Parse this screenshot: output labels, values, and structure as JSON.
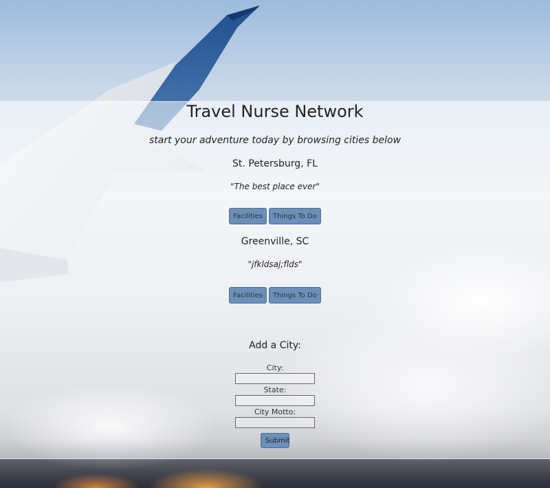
{
  "header": {
    "title": "Travel Nurse Network",
    "subtitle": "start your adventure today by browsing cities below"
  },
  "cities": [
    {
      "name": "St. Petersburg, FL",
      "motto": "\"The best place ever\"",
      "facilities_label": "Facilities",
      "things_label": "Things To Do"
    },
    {
      "name": "Greenville, SC",
      "motto": "\"jfkldsaj;flds\"",
      "facilities_label": "Facilities",
      "things_label": "Things To Do"
    }
  ],
  "add_city_form": {
    "heading": "Add a City:",
    "city_label": "City:",
    "city_value": "",
    "state_label": "State:",
    "state_value": "",
    "motto_label": "City Motto:",
    "motto_value": "",
    "submit_label": "Submit"
  },
  "colors": {
    "button_fill": "#6a8fb9",
    "wing_blue": "#2f5f9a",
    "panel_overlay": "rgba(255,255,255,0.55)"
  }
}
